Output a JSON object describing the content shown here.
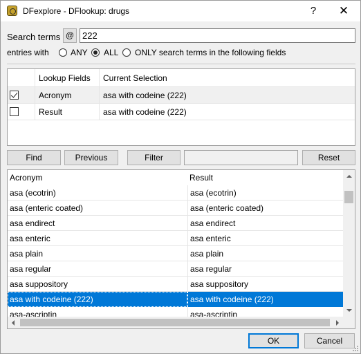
{
  "window": {
    "title": "DFexplore - DFlookup: drugs",
    "help_label": "?",
    "close_label": "✕"
  },
  "search": {
    "label": "Search terms",
    "at_label": "@",
    "value": "222"
  },
  "entries": {
    "label": "entries with",
    "options": [
      {
        "label": "ANY",
        "checked": false
      },
      {
        "label": "ALL",
        "checked": true
      },
      {
        "label": "ONLY search terms in the following fields",
        "checked": false
      }
    ]
  },
  "lookup_table": {
    "headers": [
      "",
      "Lookup Fields",
      "Current Selection"
    ],
    "rows": [
      {
        "checked": true,
        "field": "Acronym",
        "selection": "asa with codeine (222)"
      },
      {
        "checked": false,
        "field": "Result",
        "selection": "asa with codeine (222)"
      }
    ]
  },
  "buttons": {
    "find": "Find",
    "previous": "Previous",
    "filter": "Filter",
    "reset": "Reset"
  },
  "results": {
    "headers": [
      "Acronym",
      "Result"
    ],
    "rows": [
      [
        "asa (ecotrin)",
        "asa (ecotrin)"
      ],
      [
        "asa (enteric coated)",
        "asa (enteric coated)"
      ],
      [
        "asa endirect",
        "asa endirect"
      ],
      [
        "asa enteric",
        "asa enteric"
      ],
      [
        "asa plain",
        "asa plain"
      ],
      [
        "asa regular",
        "asa regular"
      ],
      [
        "asa suppository",
        "asa suppository"
      ],
      [
        "asa with codeine (222)",
        "asa with codeine (222)"
      ],
      [
        "asa-ascriptin",
        "asa-ascriptin"
      ]
    ],
    "selected_index": 7
  },
  "footer": {
    "ok": "OK",
    "cancel": "Cancel"
  },
  "colors": {
    "selection": "#0078d7",
    "app_icon": "#c6a22c"
  },
  "icons": {
    "app": "dfexplore-app-icon",
    "close": "close-icon"
  }
}
